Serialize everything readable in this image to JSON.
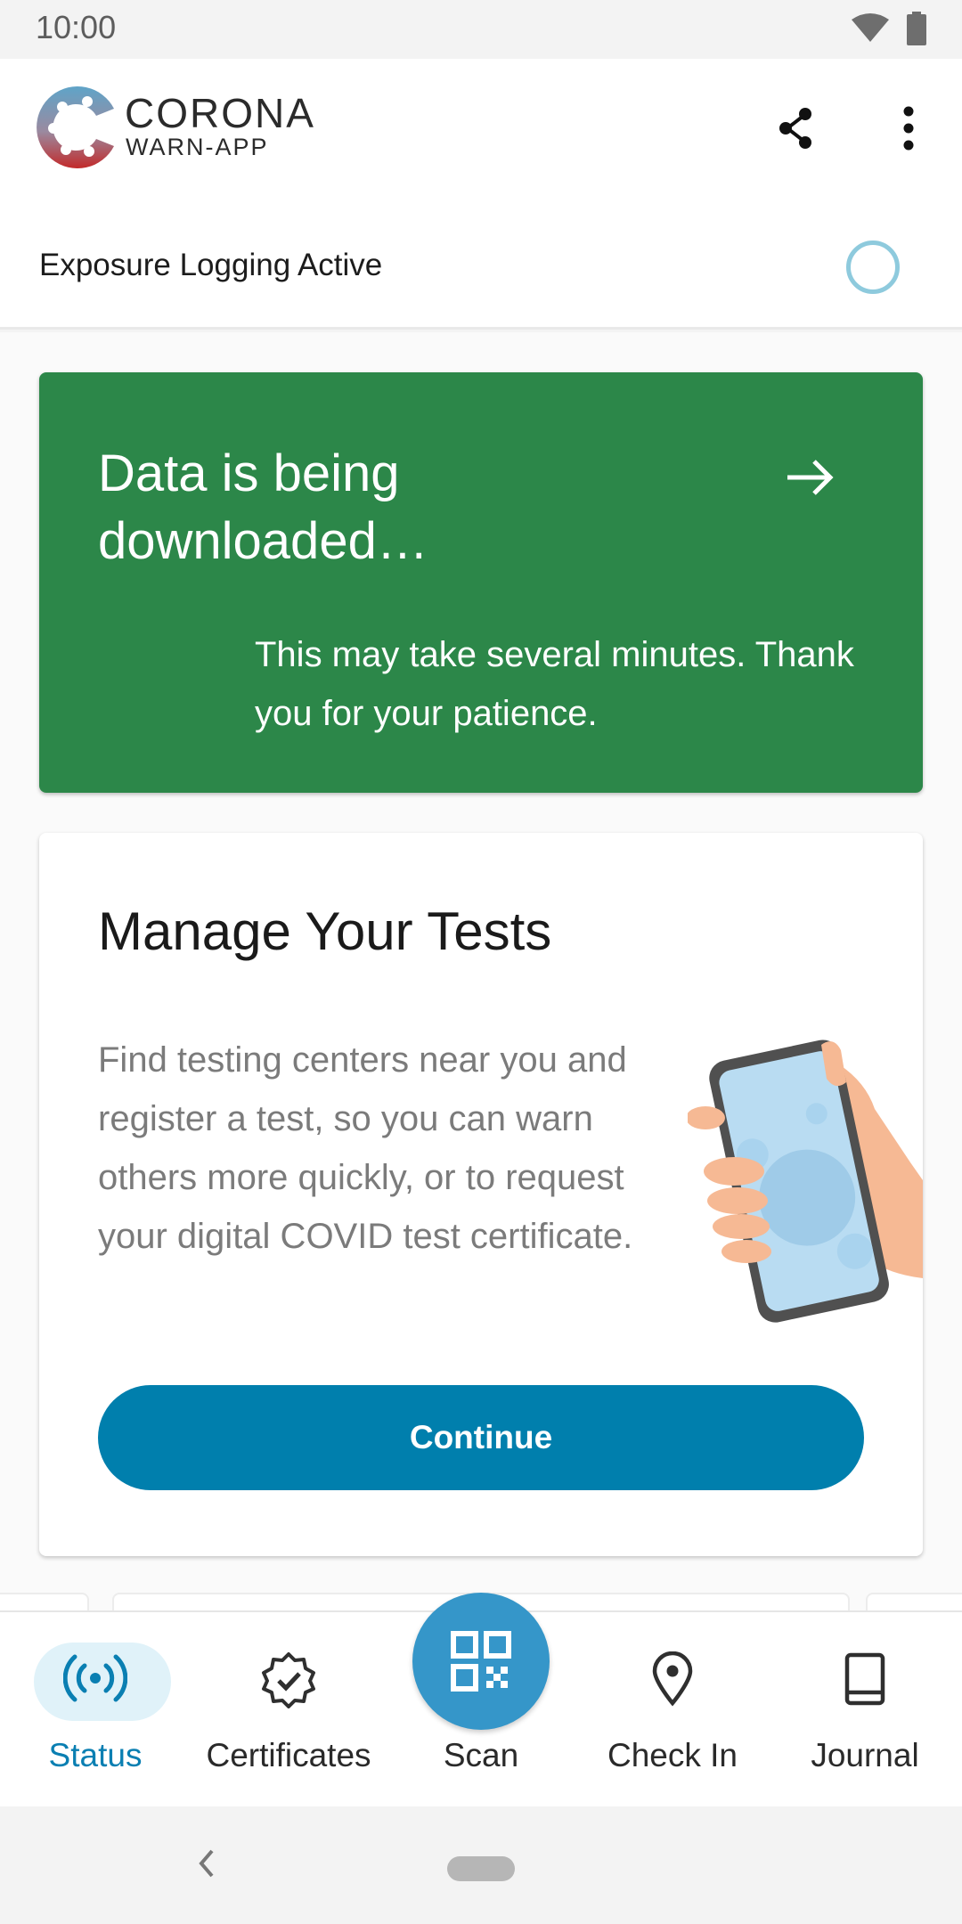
{
  "status_bar": {
    "time": "10:00",
    "wifi_icon": "wifi-icon",
    "battery_icon": "battery-icon"
  },
  "app_bar": {
    "logo_line1": "CORONA",
    "logo_line2": "WARN-APP",
    "share_icon": "share-icon",
    "more_icon": "more-vert-icon"
  },
  "exposure": {
    "label": "Exposure Logging Active",
    "ring_color": "#8ecadd"
  },
  "download_card": {
    "title": "Data is being downloaded…",
    "body": "This may take several minutes. Thank you for your patience.",
    "bg_color": "#2c8749",
    "arrow_icon": "arrow-right-icon"
  },
  "tests_card": {
    "title": "Manage Your Tests",
    "body": "Find testing centers near you and register a test, so you can warn others more quickly, or to request your digital COVID test certificate.",
    "button_label": "Continue",
    "button_color": "#007fad",
    "illustration": "hand-holding-phone-illustration"
  },
  "bottom_nav": {
    "items": [
      {
        "label": "Status",
        "icon": "radio-waves-icon",
        "active": true
      },
      {
        "label": "Certificates",
        "icon": "certificate-badge-icon",
        "active": false
      },
      {
        "label": "Scan",
        "icon": "qr-code-icon",
        "active": false
      },
      {
        "label": "Check In",
        "icon": "location-pin-icon",
        "active": false
      },
      {
        "label": "Journal",
        "icon": "book-icon",
        "active": false
      }
    ],
    "accent_color": "#0a7fb2"
  },
  "system_nav": {
    "back_icon": "back-chevron-icon",
    "home_icon": "home-pill-icon"
  }
}
